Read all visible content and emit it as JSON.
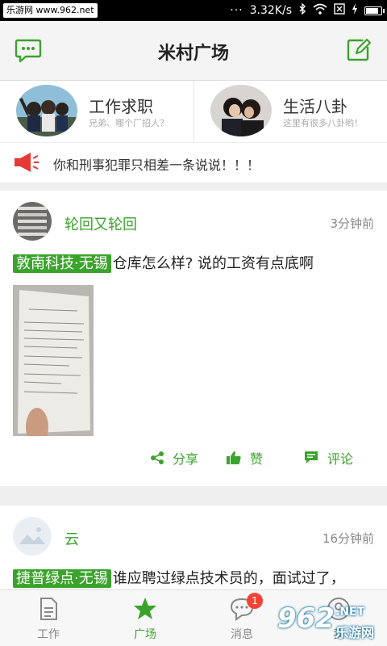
{
  "status_bar": {
    "site": "乐游网 www.962.net",
    "dots": "···",
    "speed": "3.32K/s"
  },
  "header": {
    "title": "米村广场",
    "left_icon": "message-bubble-icon",
    "right_icon": "compose-icon"
  },
  "categories": [
    {
      "title": "工作求职",
      "subtitle": "兄弟、哪个厂招人？"
    },
    {
      "title": "生活八卦",
      "subtitle": "这里有很多八卦哟！"
    }
  ],
  "notice": {
    "icon": "megaphone-icon",
    "text": "你和刑事犯罪只相差一条说说！！！"
  },
  "posts": [
    {
      "user": "轮回又轮回",
      "time": "3分钟前",
      "tag": "敦南科技·无锡",
      "text": "仓库怎么样? 说的工资有点底啊",
      "actions": {
        "share": "分享",
        "like": "赞",
        "comment": "评论"
      }
    },
    {
      "user": "云",
      "time": "16分钟前",
      "tag": "捷普绿点·无锡",
      "text": "谁应聘过绿点技术员的，面试过了，"
    }
  ],
  "bottom_nav": [
    {
      "label": "工作",
      "icon": "document-icon"
    },
    {
      "label": "广场",
      "icon": "star-icon"
    },
    {
      "label": "消息",
      "icon": "chat-icon",
      "badge": "1"
    },
    {
      "label": "我",
      "icon": "person-icon"
    }
  ],
  "watermark": {
    "big": "962",
    "small": "乐游网",
    "suffix": ".NET"
  },
  "colors": {
    "accent": "#3aa32b",
    "badge": "#f44336",
    "megaphone": "#e53935"
  }
}
